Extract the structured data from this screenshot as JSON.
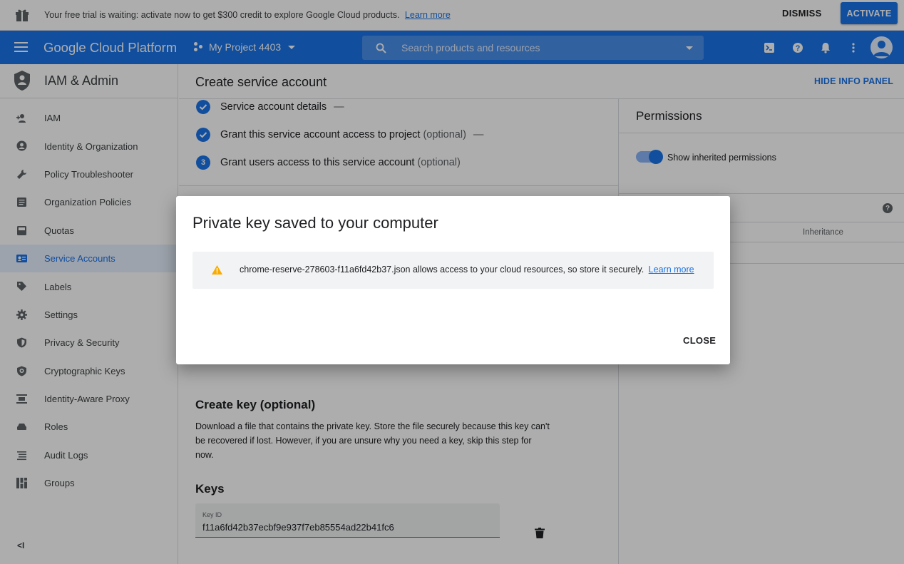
{
  "banner": {
    "message": "Your free trial is waiting: activate now to get $300 credit to explore Google Cloud products.",
    "learn_more": "Learn more",
    "dismiss": "DISMISS",
    "activate": "ACTIVATE"
  },
  "header": {
    "brand": "Google Cloud Platform",
    "project": "My Project 4403",
    "search_placeholder": "Search products and resources",
    "icons": [
      "hamburger-icon",
      "project-icon",
      "search-icon",
      "cloud-shell-icon",
      "help-icon",
      "notifications-icon",
      "more-vert-icon",
      "account-avatar"
    ]
  },
  "sidebar": {
    "title": "IAM & Admin",
    "items": [
      {
        "label": "IAM",
        "icon": "person-add-icon"
      },
      {
        "label": "Identity & Organization",
        "icon": "account-circle-icon"
      },
      {
        "label": "Policy Troubleshooter",
        "icon": "wrench-icon"
      },
      {
        "label": "Organization Policies",
        "icon": "list-icon"
      },
      {
        "label": "Quotas",
        "icon": "quota-icon"
      },
      {
        "label": "Service Accounts",
        "icon": "service-account-icon",
        "active": true
      },
      {
        "label": "Labels",
        "icon": "label-icon"
      },
      {
        "label": "Settings",
        "icon": "gear-icon"
      },
      {
        "label": "Privacy & Security",
        "icon": "shield-icon"
      },
      {
        "label": "Cryptographic Keys",
        "icon": "crypto-shield-icon"
      },
      {
        "label": "Identity-Aware Proxy",
        "icon": "iap-icon"
      },
      {
        "label": "Roles",
        "icon": "roles-icon"
      },
      {
        "label": "Audit Logs",
        "icon": "audit-icon"
      },
      {
        "label": "Groups",
        "icon": "groups-icon"
      }
    ],
    "collapse": "<I"
  },
  "main": {
    "title": "Create service account",
    "hide_info": "HIDE INFO PANEL",
    "steps": [
      {
        "label": "Service account details",
        "optional": "",
        "status": "done"
      },
      {
        "label": "Grant this service account access to project",
        "optional": "(optional)",
        "status": "done"
      },
      {
        "label": "Grant users access to this service account",
        "optional": "(optional)",
        "status": "current",
        "number": "3"
      }
    ],
    "step_dash": "—",
    "create_key_title": "Create key (optional)",
    "create_key_desc": "Download a file that contains the private key. Store the file securely because this key can't be recovered if lost. However, if you are unsure why you need a key, skip this step for now.",
    "keys_title": "Keys",
    "key_id_label": "Key ID",
    "key_id_value": "f11a6fd42b37ecbf9e937f7eb85554ad22b41fc6"
  },
  "info_panel": {
    "title": "Permissions",
    "toggle_label": "Show inherited permissions",
    "toggle_on": true,
    "column_inheritance": "Inheritance",
    "help": "?"
  },
  "dialog": {
    "title": "Private key saved to your computer",
    "notice": "chrome-reserve-278603-f11a6fd42b37.json allows access to your cloud resources, so store it securely.",
    "learn_more": "Learn more",
    "close": "CLOSE"
  },
  "colors": {
    "primary": "#1a73e8",
    "warning": "#f9ab00",
    "scrim": "rgba(0,0,0,0.32)"
  }
}
